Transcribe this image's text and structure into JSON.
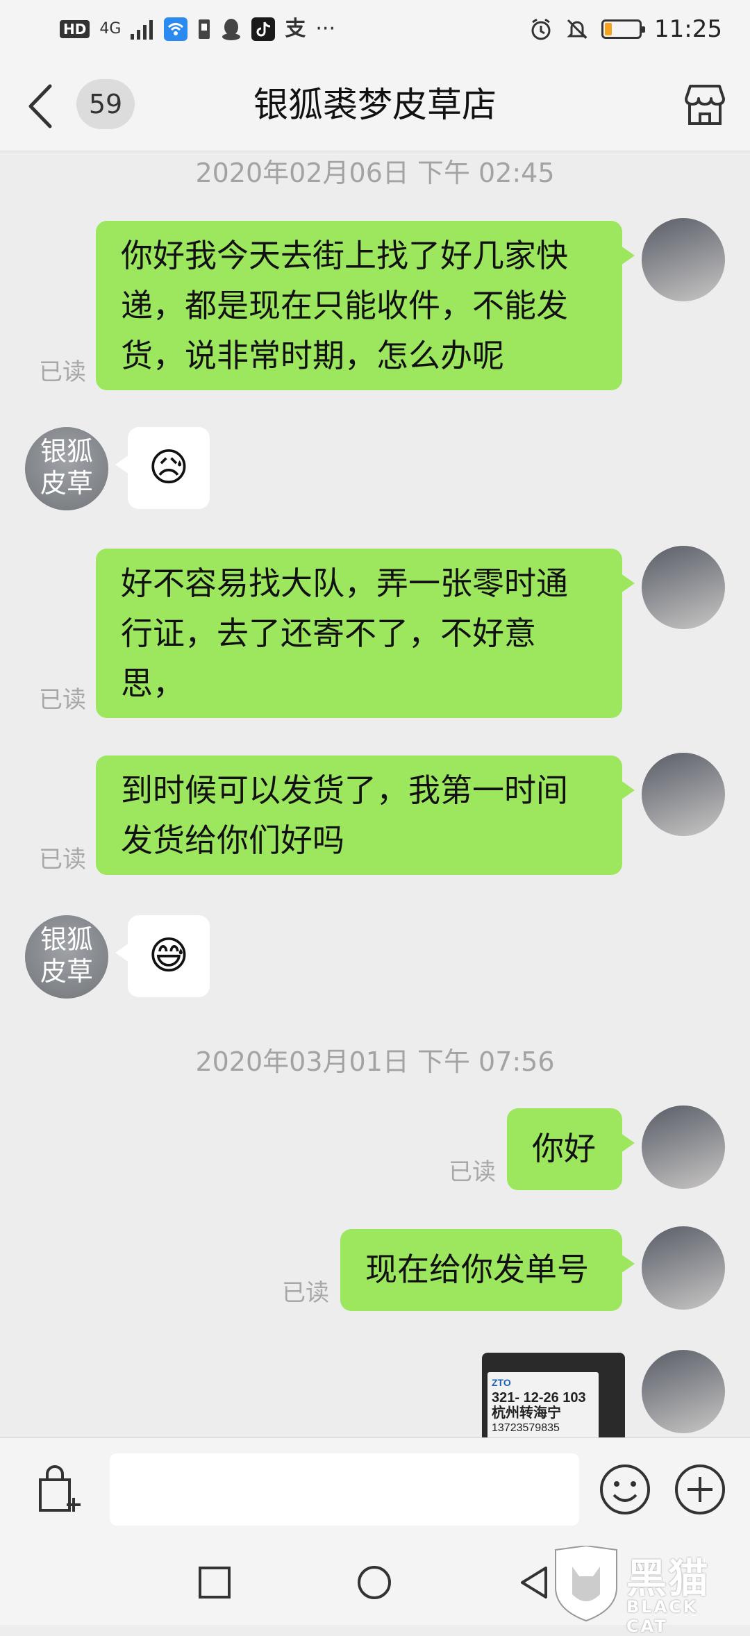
{
  "status_bar": {
    "left_badges": [
      "HD",
      "4G"
    ],
    "alipay_char": "支",
    "more": "···",
    "time": "11:25",
    "battery_level": 0.2,
    "battery_color": "#f5a21e"
  },
  "header": {
    "unread_count": "59",
    "title": "银狐裘梦皮草店"
  },
  "chat": {
    "shop_avatar_text": "银狐\n皮草",
    "timestamps": [
      "2020年02月06日 下午 02:45",
      "2020年03月01日 下午 07:56"
    ],
    "read_label": "已读",
    "messages": [
      {
        "text": "你好我今天去街上找了好几家快\n递，都是现在只能收件，不能发\n货，说非常时期，怎么办呢"
      },
      {
        "emoji": "😥"
      },
      {
        "text": "好不容易找大队，弄一张零时通\n行证，去了还寄不了，不好意\n思，"
      },
      {
        "text": "到时候可以发货了，我第一时间\n发货给你们好吗"
      },
      {
        "emoji": "😅"
      },
      {
        "text": "你好"
      },
      {
        "text": "现在给你发单号"
      }
    ],
    "image_label": {
      "line1": "321- 12-26 103",
      "line2": "杭州转海宁",
      "line3": "13723579835"
    }
  },
  "input_bar": {
    "placeholder": ""
  },
  "watermark": {
    "main": "黑猫",
    "sub": "BLACK CAT"
  },
  "colors": {
    "outgoing_bubble": "#9de75f",
    "incoming_bubble": "#ffffff",
    "background": "#ededed"
  }
}
